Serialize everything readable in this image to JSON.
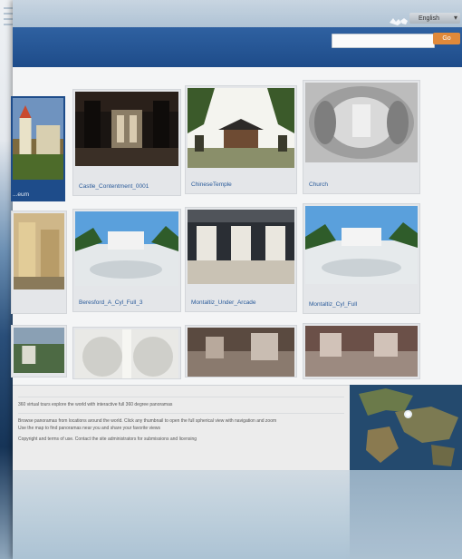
{
  "header": {
    "language_label": "English",
    "search_placeholder": "",
    "search_button_label": "Go"
  },
  "gallery": {
    "row1": [
      {
        "caption": "...eum",
        "partial": true
      },
      {
        "caption": "Castle_Contentment_0001"
      },
      {
        "caption": "ChineseTemple"
      },
      {
        "caption": "Church"
      }
    ],
    "row2": [
      {
        "caption": "",
        "partial": true
      },
      {
        "caption": "Beresford_A_Cyl_Full_3"
      },
      {
        "caption": "Montaltiz_Under_Arcade"
      },
      {
        "caption": "Montaltiz_Cyl_Full"
      }
    ],
    "row3": [
      {
        "caption": ""
      },
      {
        "caption": ""
      },
      {
        "caption": ""
      },
      {
        "caption": ""
      }
    ]
  },
  "footer": {
    "line1": "360 virtual tours explore the world with interactive full 360 degree panoramas",
    "line2": "Browse panoramas from locations around the world. Click any thumbnail to open the full spherical view with navigation and zoom",
    "line3": "Use the map to find panoramas near you and share your favorite views",
    "line4": "Copyright and terms of use. Contact the site administrators for submissions and licensing"
  },
  "colors": {
    "header_blue": "#1e4c8a",
    "caption_blue": "#2a5b9a",
    "search_button_orange": "#e0893a"
  }
}
